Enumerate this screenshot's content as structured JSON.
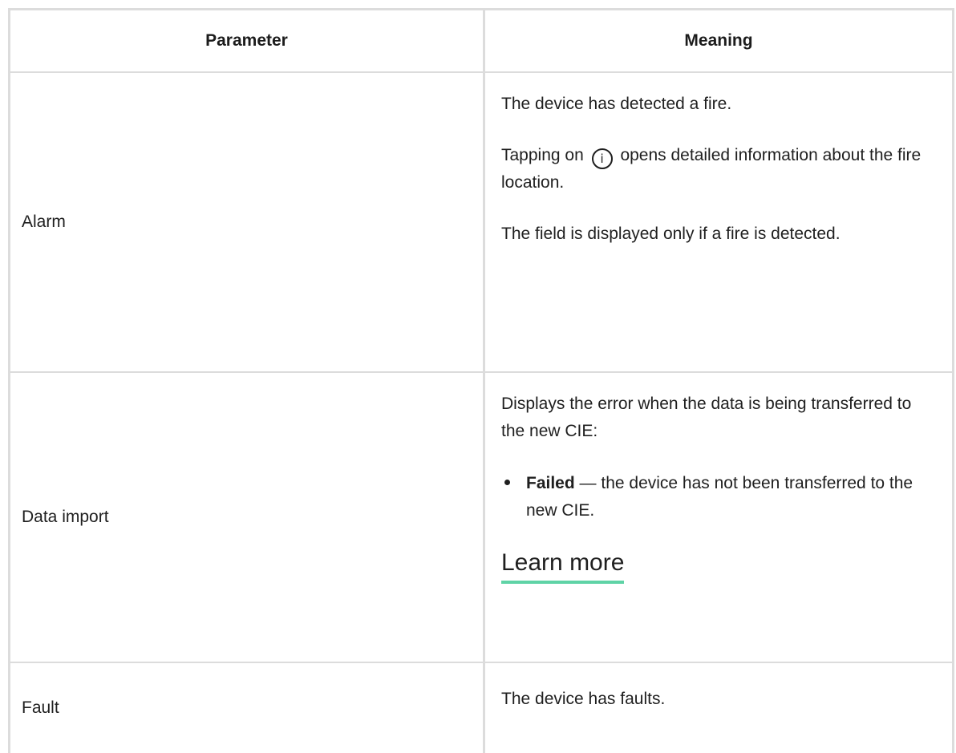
{
  "table": {
    "headers": {
      "parameter": "Parameter",
      "meaning": "Meaning"
    },
    "rows": [
      {
        "parameter": "Alarm",
        "meaning": {
          "p1": "The device has detected a fire.",
          "p2_before": "Tapping on",
          "p2_icon": "i",
          "p2_after": "opens detailed information about the fire location.",
          "p3": "The field is displayed only if a fire is detected."
        }
      },
      {
        "parameter": "Data import",
        "meaning": {
          "p1": "Displays the error when the data is being transferred to the new CIE:",
          "bullet_bold": "Failed",
          "bullet_rest": " — the device has not been transferred to the new CIE.",
          "link": "Learn more"
        }
      },
      {
        "parameter": "Fault",
        "meaning": {
          "p1": "The device has faults."
        }
      }
    ]
  },
  "icons": {
    "info": "info-circle-icon"
  },
  "colors": {
    "link_underline": "#5fd3a6",
    "border": "#dcdcdc",
    "text": "#1f1f1f"
  }
}
